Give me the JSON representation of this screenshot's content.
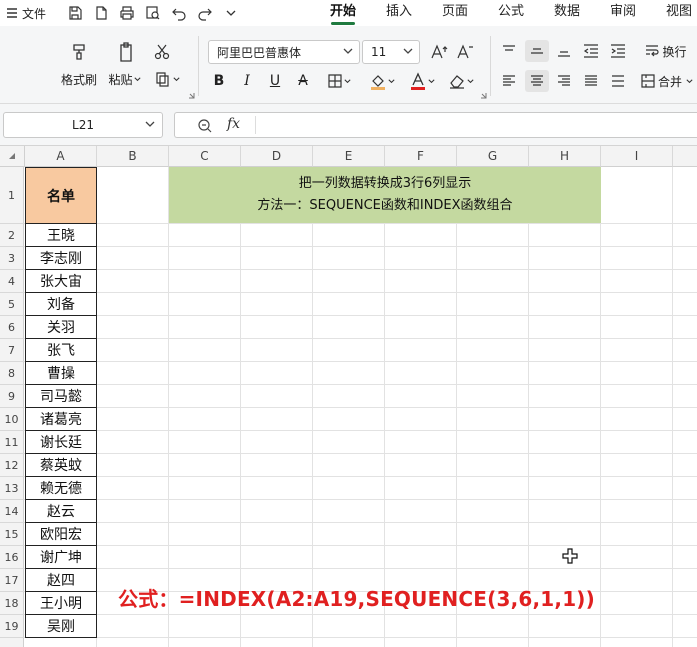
{
  "menu": {
    "file_label": "文件",
    "tabs": [
      "开始",
      "插入",
      "页面",
      "公式",
      "数据",
      "审阅",
      "视图"
    ],
    "active_tab": "开始"
  },
  "ribbon": {
    "format_painter": "格式刷",
    "paste": "粘贴",
    "font_name": "阿里巴巴普惠体",
    "font_size": "11",
    "wrap_text": "换行",
    "merge": "合并"
  },
  "formula_bar": {
    "name_box": "L21",
    "formula": ""
  },
  "columns": [
    "A",
    "B",
    "C",
    "D",
    "E",
    "F",
    "G",
    "H",
    "I"
  ],
  "rows": [
    "1",
    "2",
    "3",
    "4",
    "5",
    "6",
    "7",
    "8",
    "9",
    "10",
    "11",
    "12",
    "13",
    "14",
    "15",
    "16",
    "17",
    "18",
    "19"
  ],
  "sheet": {
    "header": "名单",
    "names": [
      "王晓",
      "李志刚",
      "张大宙",
      "刘备",
      "关羽",
      "张飞",
      "曹操",
      "司马懿",
      "诸葛亮",
      "谢长廷",
      "蔡英蚊",
      "赖无德",
      "赵云",
      "欧阳宏",
      "谢广坤",
      "赵四",
      "王小明",
      "吴刚"
    ],
    "title_line1": "把一列数据转换成3行6列显示",
    "title_line2": "方法一：SEQUENCE函数和INDEX函数组合",
    "formula_note": "公式：=INDEX(A2:A19,SEQUENCE(3,6,1,1))"
  },
  "colors": {
    "header_fill": "#f8c9a0",
    "title_fill": "#c4d9a0",
    "formula_text": "#e02020",
    "active_tab_underline": "#1f7a3f"
  }
}
